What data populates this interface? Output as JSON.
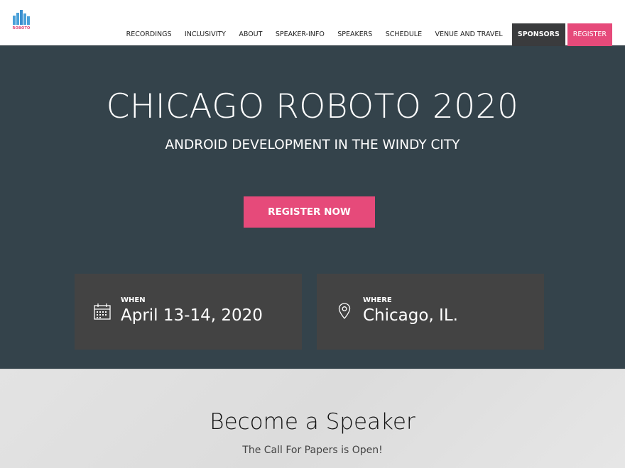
{
  "header": {
    "logo_text": "ROBOTO",
    "nav": [
      {
        "label": "RECORDINGS"
      },
      {
        "label": "INCLUSIVITY"
      },
      {
        "label": "ABOUT"
      },
      {
        "label": "SPEAKER-INFO"
      },
      {
        "label": "SPEAKERS"
      },
      {
        "label": "SCHEDULE"
      },
      {
        "label": "VENUE AND TRAVEL"
      },
      {
        "label": "SPONSORS"
      },
      {
        "label": "REGISTER"
      }
    ]
  },
  "hero": {
    "title": "CHICAGO ROBOTO 2020",
    "subtitle": "ANDROID DEVELOPMENT IN THE WINDY CITY",
    "cta_label": "REGISTER NOW",
    "when": {
      "label": "WHEN",
      "value": "April 13-14, 2020",
      "icon": "calendar-icon"
    },
    "where": {
      "label": "WHERE",
      "value": "Chicago, IL.",
      "icon": "location-pin-icon"
    }
  },
  "speaker_section": {
    "title": "Become a Speaker",
    "subtitle": "The Call For Papers is Open!"
  },
  "colors": {
    "hero_bg": "#34434b",
    "card_bg": "#434343",
    "accent_pink": "#e64a7a",
    "sponsors_bg": "#3a3b3d"
  }
}
